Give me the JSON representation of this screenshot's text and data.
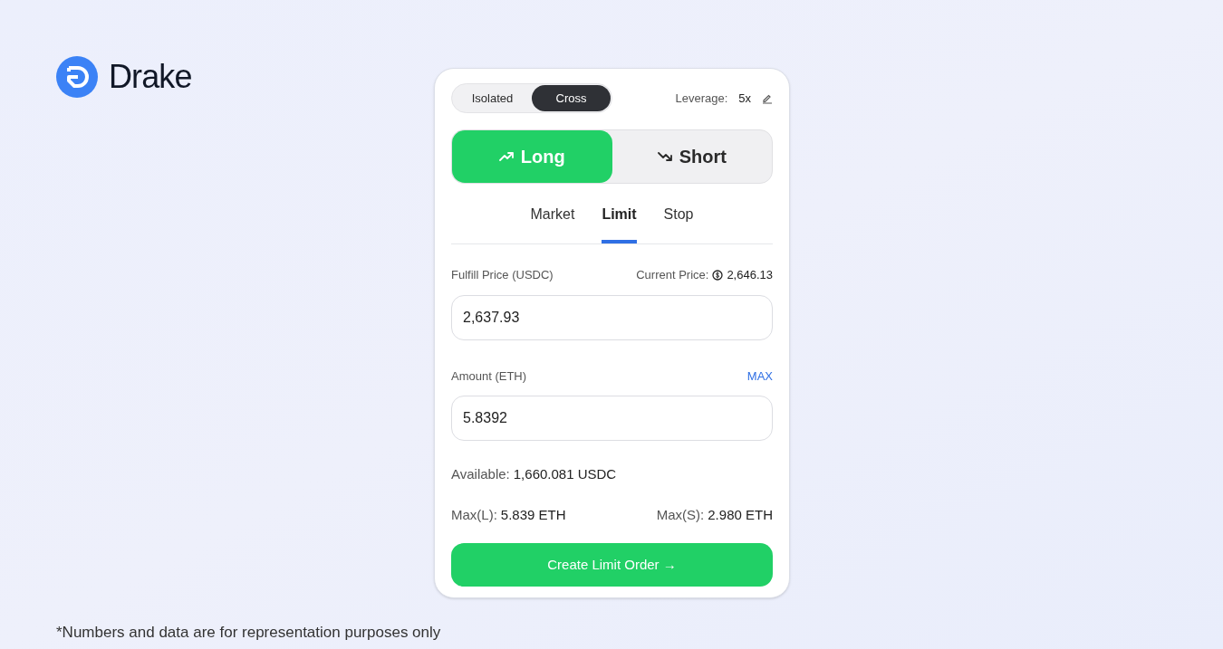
{
  "brand": {
    "name": "Drake"
  },
  "margin_modes": [
    {
      "label": "Isolated",
      "selected": false
    },
    {
      "label": "Cross",
      "selected": true
    }
  ],
  "leverage": {
    "label": "Leverage:",
    "value": "5x"
  },
  "sides": [
    {
      "label": "Long",
      "kind": "up",
      "selected": true
    },
    {
      "label": "Short",
      "kind": "down",
      "selected": false
    }
  ],
  "order_tabs": [
    {
      "label": "Market",
      "selected": false
    },
    {
      "label": "Limit",
      "selected": true
    },
    {
      "label": "Stop",
      "selected": false
    }
  ],
  "price": {
    "label": "Fulfill Price (USDC)",
    "current_label": "Current Price:",
    "current_value": "2,646.13",
    "value": "2,637.93"
  },
  "amount": {
    "label": "Amount (ETH)",
    "max_link": "MAX",
    "value": "5.8392"
  },
  "available": {
    "label": "Available:",
    "value": "1,660.081 USDC"
  },
  "max_long": {
    "label": "Max(L):",
    "value": "5.839 ETH"
  },
  "max_short": {
    "label": "Max(S):",
    "value": "2.980 ETH"
  },
  "submit": "Create Limit Order →",
  "disclaimer": "*Numbers and data are for representation purposes only"
}
